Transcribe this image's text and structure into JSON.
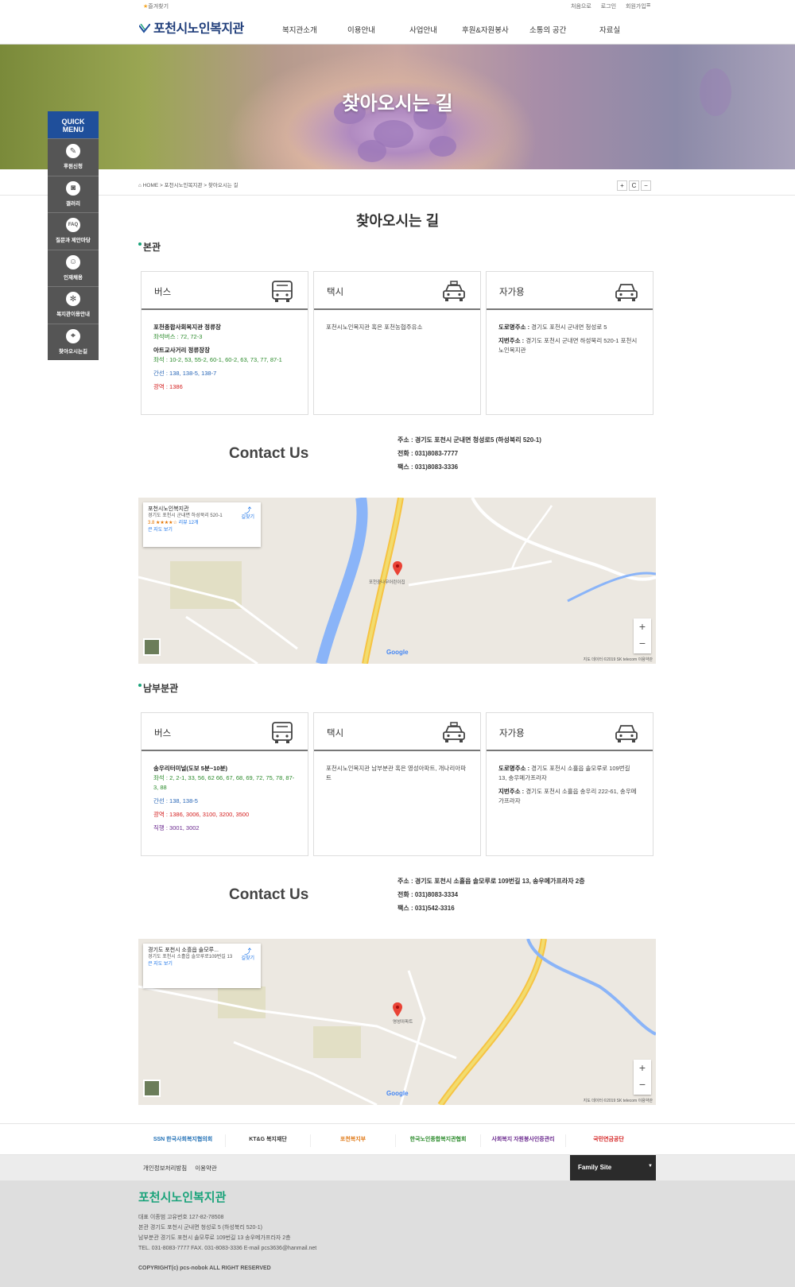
{
  "topbar": {
    "favorite": "즐겨찾기",
    "home": "처음으로",
    "login": "로그인",
    "join": "회원가입"
  },
  "header": {
    "logo": "포천시노인복지관",
    "nav": [
      "복지관소개",
      "이용안내",
      "사업안내",
      "후원&자원봉사",
      "소통의 공간",
      "자료실"
    ]
  },
  "hero": {
    "title": "찾아오시는 길"
  },
  "quick_menu": {
    "title_1": "QUICK",
    "title_2": "MENU",
    "items": [
      "후원신청",
      "갤러리",
      "질문과 제안마당",
      "인재채용",
      "복지관이용안내",
      "찾아오시는길"
    ]
  },
  "breadcrumb": {
    "path": "HOME >  포천시노인복지관 >  찾아오시는 길",
    "zoom_in": "+",
    "reset": "C",
    "zoom_out": "−"
  },
  "page_title": "찾아오시는 길",
  "main_branch": {
    "title": "본관",
    "bus": {
      "label": "버스",
      "stop1": "포천종합사회복지관 정류장",
      "stop1_seat": "좌석버스 : ",
      "stop1_seat_val": "72, 72-3",
      "stop2": "아트교사거리 정류장장",
      "stop2_seat": "좌석 : ",
      "stop2_seat_val": "10-2, 53, 55-2, 60-1, 60-2, 63, 73, 77, 87-1",
      "trunk": "간선 : 138, 138-5, 138-7",
      "wide": "광역 : 1386"
    },
    "taxi": {
      "label": "택시",
      "text": "포천시노인복지관 혹은 포천농협주유소"
    },
    "car": {
      "label": "자가용",
      "road_key": "도로명주소 : ",
      "road": "경기도 포천시 군내면 청성로 5",
      "lot_key": "지번주소 : ",
      "lot": "경기도 포천시 군내면 하성북리 520-1 포천시노인복지관"
    },
    "contact_title": "Contact Us",
    "address": "주소 : 경기도 포천시 군내면 청성로5 (하성북리 520-1)",
    "phone": "전화 : 031)8083-7777",
    "fax": "팩스 : 031)8083-3336",
    "map": {
      "card_name": "포천시노인복지관",
      "card_addr": "경기도 포천시 군내면 하성북리 520-1",
      "card_rating": "3.8 ★★★★☆",
      "card_reviews": "리뷰 12개",
      "card_dir": "길찾기",
      "card_link": "큰 지도 보기",
      "place": "포천중나무어린이집",
      "google": "Google",
      "copyright": "지도 데이터 ©2019 SK telecom   이용약관"
    }
  },
  "south_branch": {
    "title": "남부분관",
    "bus": {
      "label": "버스",
      "stop1": "송우리터미널(도보 5분~10분)",
      "seat_key": "좌석 : ",
      "seat": "2, 2-1, 33, 56, 62 66, 67, 68, 69, 72, 75, 78, 87-3, 88",
      "trunk": "간선 : 138, 138-5",
      "wide": "광역 : 1386, 3006, 3100, 3200, 3500",
      "direct": "직행 : 3001, 3002"
    },
    "taxi": {
      "label": "택시",
      "text": "포천시노인복지관 남부분관 혹은 영성아파트, 개나리아파트"
    },
    "car": {
      "label": "자가용",
      "road_key": "도로명주소 : ",
      "road": "경기도 포천시 소흘읍 솔모루로 109번길 13, 송우메가프라자",
      "lot_key": "지번주소 : ",
      "lot": "경기도 포천시 소흘읍 송우리 222-61, 송우메가프라자"
    },
    "contact_title": "Contact Us",
    "address": "주소 : 경기도 포천시 소흘읍 솔모루로 109번길 13, 송우메가프라자 2층",
    "phone": "전화 : 031)8083-3334",
    "fax": "팩스 : 031)542-3316",
    "map": {
      "card_name": "경기도 포천시 소흘읍 솔모루...",
      "card_addr": "경기도 포천시 소흘읍 솔모루로109번길 13",
      "card_dir": "길찾기",
      "card_link": "큰 지도 보기",
      "place": "영성아파트",
      "google": "Google",
      "copyright": "지도 데이터 ©2019 SK telecom   이용약관"
    }
  },
  "partners": [
    "SSN 한국사회복지협의회",
    "KT&G 복지재단",
    "포천복지부",
    "한국노인종합복지관협회",
    "사회복지 자원봉사인증관리",
    "국민연금공단"
  ],
  "footer_nav": {
    "privacy": "개인정보처리방침",
    "terms": "이용약관",
    "family": "Family Site"
  },
  "footer": {
    "name": "포천시노인복지관",
    "line1": "대표   이종범     고유번호    127-82-78508",
    "line2": "본관     경기도 포천시 군내면 청성로 5 (하성북리 520-1)",
    "line3": "남부분관     경기도 포천시 솔모루로 109번길 13 송우메가프라자 2층",
    "line4": "TEL.    031-8083-7777    FAX.    031-8083-3336    E-mail    pcs3636@hanmail.net",
    "copyright": "COPYRIGHT(c) pcs-nobok ALL RIGHT RESERVED"
  },
  "colors": {
    "brand": "#1f4f9b",
    "green": "#1aa37a",
    "bus_green": "#2a8a2a",
    "bus_blue": "#2866b7",
    "bus_red": "#d42020"
  }
}
